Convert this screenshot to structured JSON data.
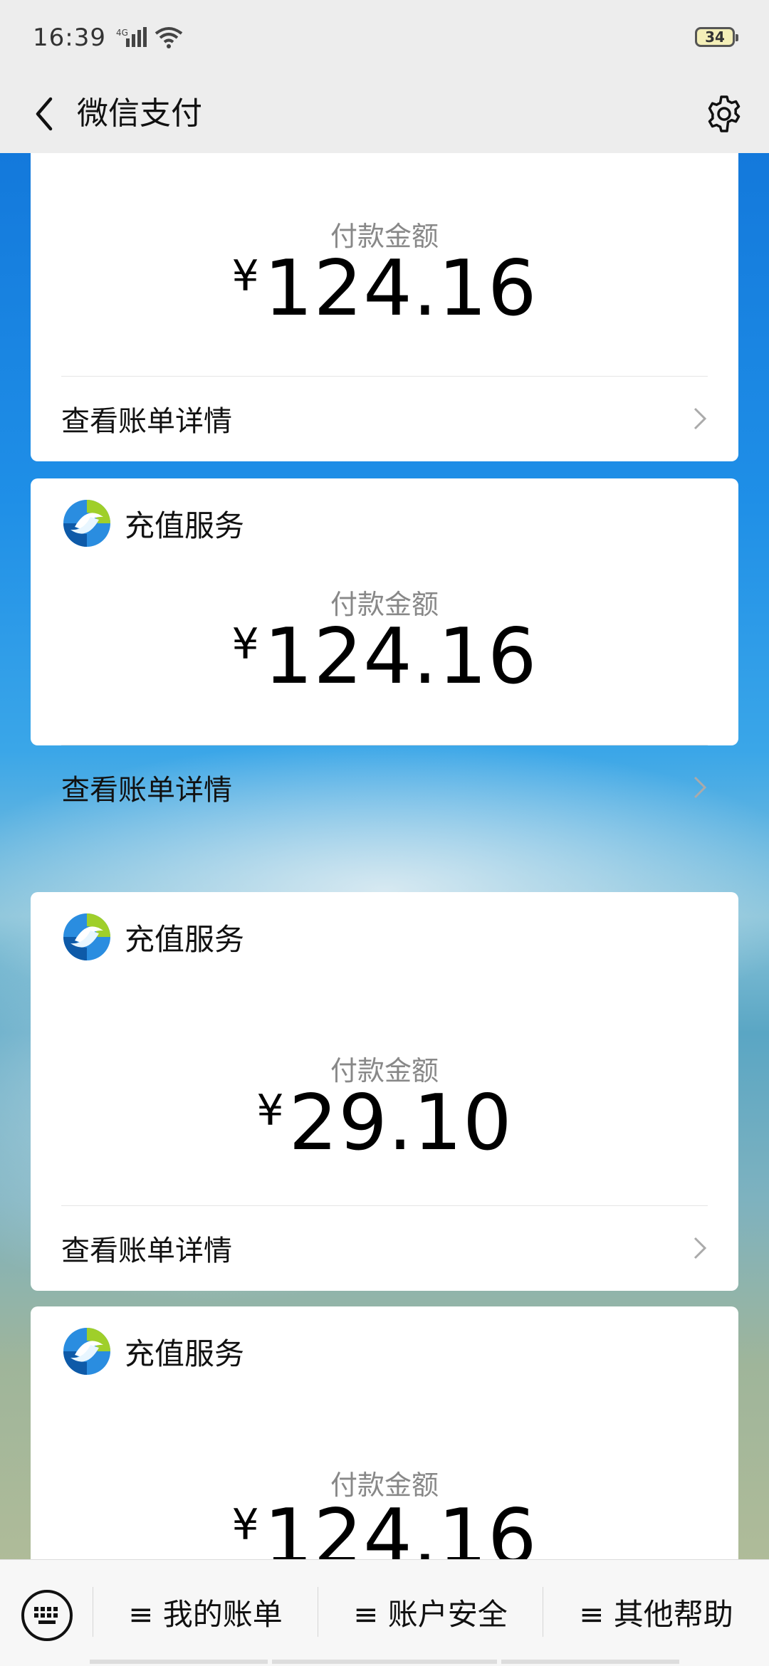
{
  "status": {
    "time": "16:39",
    "network": "4G",
    "battery": "34"
  },
  "nav": {
    "title": "微信支付"
  },
  "cards": [
    {
      "merchant": "",
      "amount_label": "付款金额",
      "currency": "¥",
      "amount": "124.16",
      "detail_link": "查看账单详情"
    },
    {
      "merchant": "充值服务",
      "amount_label": "付款金额",
      "currency": "¥",
      "amount": "124.16",
      "detail_link": "查看账单详情"
    },
    {
      "merchant": "充值服务",
      "amount_label": "付款金额",
      "currency": "¥",
      "amount": "29.10",
      "detail_link": "查看账单详情"
    },
    {
      "merchant": "充值服务",
      "amount_label": "付款金额",
      "currency": "¥",
      "amount": "124.16",
      "detail_link": ""
    }
  ],
  "bottom_menu": [
    {
      "label": "≡ 我的账单"
    },
    {
      "label": "≡ 账户安全"
    },
    {
      "label": "≡ 其他帮助"
    }
  ],
  "icons": {
    "back": "chevron-left-icon",
    "settings": "gear-icon",
    "merchant": "recharge-logo-icon",
    "keyboard": "keyboard-icon",
    "chevron": "chevron-right-icon"
  },
  "colors": {
    "nav_bg": "#ededed",
    "card_bg": "#ffffff",
    "amount_label": "#888888"
  }
}
